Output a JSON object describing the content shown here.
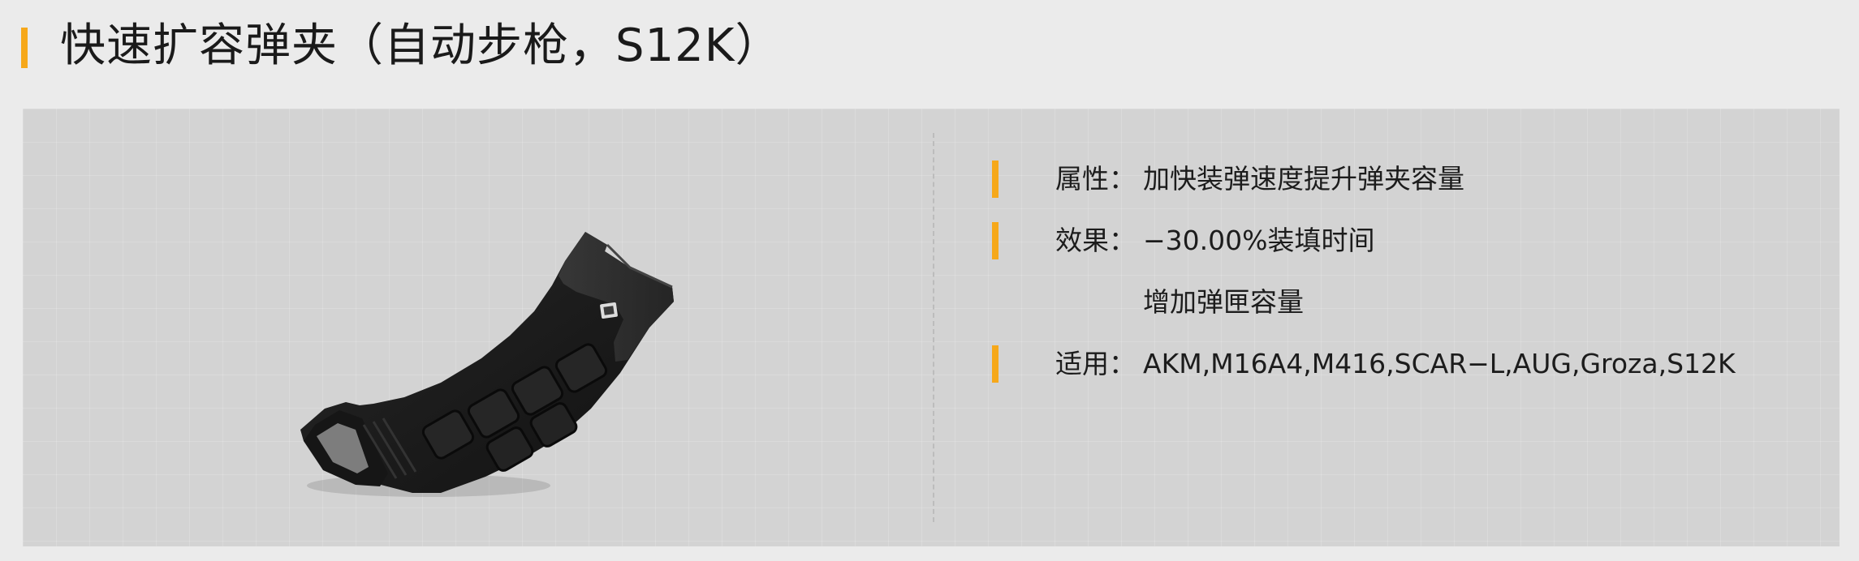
{
  "header": {
    "title": "快速扩容弹夹（自动步枪，S12K）"
  },
  "details": {
    "attribute": {
      "label": "属性：",
      "value": "加快装弹速度提升弹夹容量"
    },
    "effect": {
      "label": "效果：",
      "value": "−30.00%装填时间",
      "value_extra": "增加弹匣容量"
    },
    "applies_to": {
      "label": "适用：",
      "value": "AKM,M16A4,M416,SCAR−L,AUG,Groza,S12K"
    }
  },
  "colors": {
    "accent": "#f6a81a",
    "card_bg": "#d3d3d3",
    "page_bg": "#ebebeb"
  },
  "icons": {
    "item": "extended-magazine-icon"
  }
}
